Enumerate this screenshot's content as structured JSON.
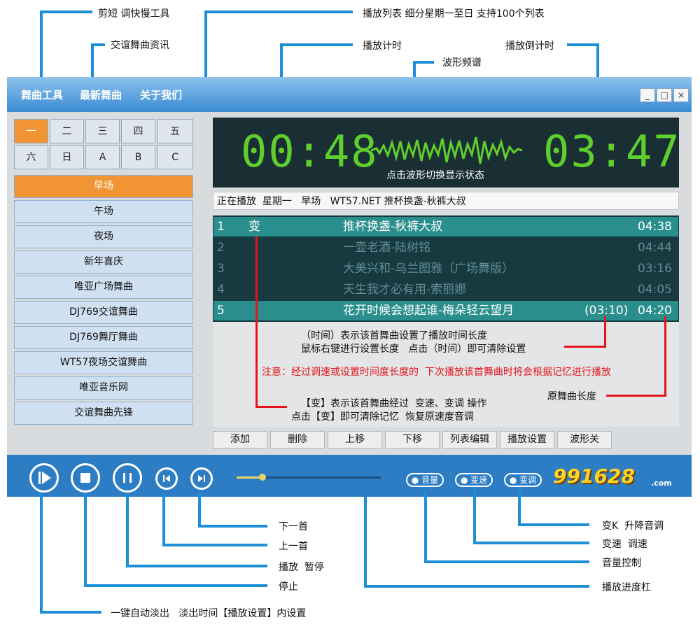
{
  "callouts_top": {
    "cut": "剪短 调快慢工具",
    "news": "交谊舞曲资讯",
    "playlist": "播放列表  细分星期一至日  支持100个列表",
    "play_timer": "播放计时",
    "waveform": "波形频谱",
    "countdown": "播放倒计时"
  },
  "menu": [
    "舞曲工具",
    "最新舞曲",
    "关于我们"
  ],
  "window_buttons": {
    "min": "_",
    "max": "□",
    "close": "×"
  },
  "days_row1": [
    "一",
    "二",
    "三",
    "四",
    "五"
  ],
  "days_row2": [
    "六",
    "日",
    "A",
    "B",
    "C"
  ],
  "categories": [
    "早场",
    "午场",
    "夜场",
    "新年喜庆",
    "唯亚广场舞曲",
    "DJ769交谊舞曲",
    "DJ769舞厅舞曲",
    "WT57夜场交谊舞曲",
    "唯亚音乐网",
    "交谊舞曲先锋"
  ],
  "display": {
    "elapsed": "00:48",
    "remaining": "03:47",
    "hint": "点击波形切换显示状态"
  },
  "now_playing": "正在播放  星期一   早场   WT57.NET 推杯换盏-秋裤大叔",
  "tracks": [
    {
      "num": "1",
      "flag": "变",
      "title": "推杯换盏-秋裤大叔",
      "set": "",
      "dur": "04:38"
    },
    {
      "num": "2",
      "flag": "",
      "title": "一壶老酒-陆树铭",
      "set": "",
      "dur": "04:44"
    },
    {
      "num": "3",
      "flag": "",
      "title": "大美兴和-乌兰图雅（广场舞版）",
      "set": "",
      "dur": "03:16"
    },
    {
      "num": "4",
      "flag": "",
      "title": "天生我才必有用-索丽娜",
      "set": "",
      "dur": "04:05"
    },
    {
      "num": "5",
      "flag": "",
      "title": "花开时候会想起谁-梅朵轻云望月",
      "set": "(03:10)",
      "dur": "04:20"
    }
  ],
  "notes": {
    "line1": "（时间）表示该首舞曲设置了播放时间长度",
    "line2": "鼠标右键进行设置长度   点击（时间）即可清除设置",
    "warn": "注意：经过调速或设置时间度长度的  下次播放该首舞曲时将会根据记忆进行播放",
    "orig_len": "原舞曲长度",
    "line3": "【变】表示该首舞曲经过  变速、变调 操作",
    "line4": "点击【变】即可清除记忆  恢复原速度音调"
  },
  "toolbar": [
    "添加",
    "删除",
    "上移",
    "下移",
    "列表编辑",
    "播放设置",
    "波形关"
  ],
  "controls": {
    "progress": 0.18,
    "volume": "音量",
    "speed": "变速",
    "pitch": "变调",
    "logo": "991628",
    "logo_suffix": ".com"
  },
  "callouts_bottom": {
    "next": "下一首",
    "prev": "上一首",
    "play": "播放  暂停",
    "stop": "停止",
    "fade": "一键自动淡出   淡出时间【播放设置】内设置",
    "key": "变K  升降音调",
    "tempo": "变速  调速",
    "vol": "音量控制",
    "progress": "播放进度杠"
  },
  "colors": {
    "accent_orange": "#f19534",
    "lcd_green": "#5fcf2e",
    "callout_blue": "#1d8fd6",
    "note_red": "#e3141b"
  }
}
